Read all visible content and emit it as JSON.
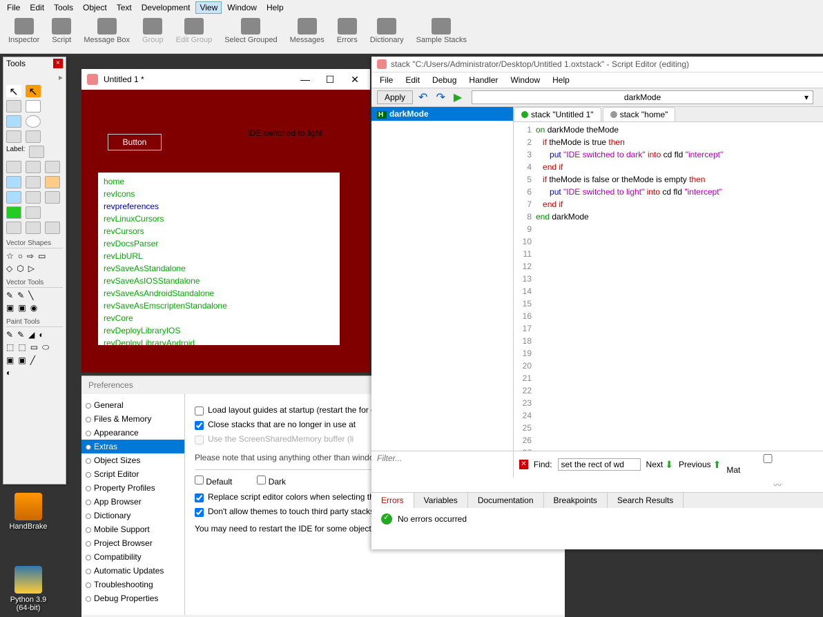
{
  "desktop": {
    "handbrake": "HandBrake",
    "python": "Python 3.9\n(64-bit)"
  },
  "main_menu": [
    "File",
    "Edit",
    "Tools",
    "Object",
    "Text",
    "Development",
    "View",
    "Window",
    "Help"
  ],
  "main_menu_selected": "View",
  "toolbar": [
    {
      "label": "Inspector"
    },
    {
      "label": "Script"
    },
    {
      "label": "Message Box"
    },
    {
      "label": "Group",
      "disabled": true
    },
    {
      "label": "Edit Group",
      "disabled": true
    },
    {
      "label": "Select Grouped"
    },
    {
      "label": "Messages"
    },
    {
      "label": "Errors"
    },
    {
      "label": "Dictionary"
    },
    {
      "label": "Sample Stacks"
    }
  ],
  "tools_palette": {
    "title": "Tools",
    "label_txt": "Label:",
    "sections": [
      "Vector Shapes",
      "Vector Tools",
      "Paint Tools"
    ]
  },
  "stack": {
    "title": "Untitled 1 *",
    "button_label": "Button",
    "intercept_text": "IDE switched to light",
    "list": [
      {
        "t": "home",
        "c": "sl-green"
      },
      {
        "t": "revIcons",
        "c": "sl-green"
      },
      {
        "t": "revpreferences",
        "c": "sl-blue"
      },
      {
        "t": "revLinuxCursors",
        "c": "sl-green"
      },
      {
        "t": "revCursors",
        "c": "sl-green"
      },
      {
        "t": "revDocsParser",
        "c": "sl-green"
      },
      {
        "t": "revLibURL",
        "c": "sl-green"
      },
      {
        "t": "revSaveAsStandalone",
        "c": "sl-green"
      },
      {
        "t": "revSaveAsIOSStandalone",
        "c": "sl-green"
      },
      {
        "t": "revSaveAsAndroidStandalone",
        "c": "sl-green"
      },
      {
        "t": "revSaveAsEmscriptenStandalone",
        "c": "sl-green"
      },
      {
        "t": "revCore",
        "c": "sl-green"
      },
      {
        "t": "revDeployLibraryIOS",
        "c": "sl-green"
      },
      {
        "t": "revDeployLibraryAndroid",
        "c": "sl-green"
      }
    ]
  },
  "prefs": {
    "title": "Preferences",
    "items": [
      "General",
      "Files & Memory",
      "Appearance",
      "Extras",
      "Object Sizes",
      "Script Editor",
      "Property Profiles",
      "App Browser",
      "Dictionary",
      "Mobile Support",
      "Project Browser",
      "Compatibility",
      "Automatic Updates",
      "Troubleshooting",
      "Debug Properties"
    ],
    "selected": "Extras",
    "ck_load": "Load layout guides at startup (restart the for changes to take effect)",
    "ck_close": "Close stacks that are no longer in use at",
    "ck_shared": "Use the ScreenSharedMemory buffer (li",
    "note1": "Please note that using anything other than windows is experimental. Titlebars of back correctly.",
    "radio_default": "Default",
    "radio_dark": "Dark",
    "ck_replace": "Replace script editor colors when selecting theme",
    "ck_dontallow": "Don't allow themes to touch third party stacks at all",
    "note2": "You may need to restart the IDE for some objects to appear correctly."
  },
  "editor": {
    "win_title": "stack \"C:/Users/Administrator/Desktop/Untitled 1.oxtstack\" - Script Editor (editing)",
    "menu": [
      "File",
      "Edit",
      "Debug",
      "Handler",
      "Window",
      "Help"
    ],
    "apply": "Apply",
    "combo": "darkMode",
    "tree_node": "darkMode",
    "tabs": [
      {
        "label": "stack \"Untitled 1\"",
        "dot": "dot-green"
      },
      {
        "label": "stack \"home\"",
        "dot": "dot-grey"
      }
    ],
    "filter_placeholder": "Filter...",
    "find_label": "Find:",
    "find_value": "set the rect of wd",
    "next": "Next",
    "prev": "Previous",
    "mat": "Mat",
    "tabs2": [
      "Errors",
      "Variables",
      "Documentation",
      "Breakpoints",
      "Search Results"
    ],
    "tabs2_selected": "Errors",
    "no_errors": "No errors occurred"
  }
}
